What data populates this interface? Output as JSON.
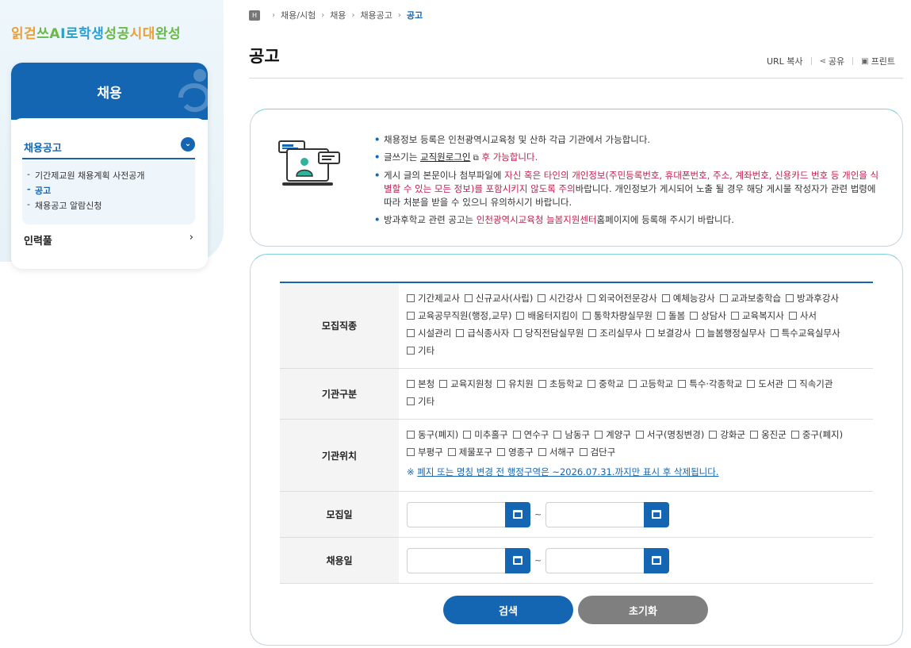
{
  "slogan": "읽걷쓰AI로 학생성공시대 완성",
  "sidebar": {
    "title": "채용",
    "menu": [
      {
        "label": "채용공고",
        "expanded": true,
        "children": [
          "기간제교원 채용계획 사전공개",
          "공고",
          "채용공고 알람신청"
        ]
      },
      {
        "label": "인력풀"
      }
    ]
  },
  "breadcrumb": [
    "채용/시험",
    "채용",
    "채용공고",
    "공고"
  ],
  "page_title": "공고",
  "utils": {
    "url_copy": "URL 복사",
    "share": "공유",
    "print": "프린트"
  },
  "notice": {
    "items": [
      "채용정보 등록은 인천광역시교육청 및 산하 각급 기관에서 가능합니다.",
      {
        "pre": "글쓰기는 ",
        "link": "교직원로그인",
        "post": " 후 가능합니다."
      },
      {
        "pre": "게시 글의 본문이나 첨부파일에 ",
        "red": "자신 혹은 타인의 개인정보(주민등록번호, 휴대폰번호, 주소, 계좌번호, 신용카드 번호 등 개인을 식별할 수 있는 모든 정보)를 포함시키지 않도록 주의",
        "post": "바랍니다. 개인정보가 게시되어 노출 될 경우 해당 게시물 작성자가 관련 법령에 따라 처분을 받을 수 있으니 유의하시기 바랍니다."
      },
      {
        "pre": "방과후학교 관련 공고는 ",
        "red": "인천광역시교육청 늘봄지원센터",
        "post": "홈페이지에 등록해 주시기 바랍니다."
      }
    ]
  },
  "search": {
    "recruit_type": {
      "label": "모집직종",
      "options": [
        "기간제교사",
        "신규교사(사립)",
        "시간강사",
        "외국어전문강사",
        "예체능강사",
        "교과보충학습",
        "방과후강사",
        "교육공무직원(행정,교무)",
        "배움터지킴이",
        "통학차량실무원",
        "돌봄",
        "상담사",
        "교육복지사",
        "사서",
        "시설관리",
        "급식종사자",
        "당직전담실무원",
        "조리실무사",
        "보결강사",
        "늘봄행정실무사",
        "특수교육실무사",
        "기타"
      ]
    },
    "org_type": {
      "label": "기관구분",
      "options": [
        "본청",
        "교육지원청",
        "유치원",
        "초등학교",
        "중학교",
        "고등학교",
        "특수·각종학교",
        "도서관",
        "직속기관",
        "기타"
      ]
    },
    "org_location": {
      "label": "기관위치",
      "options": [
        "동구(폐지)",
        "미추홀구",
        "연수구",
        "남동구",
        "계양구",
        "서구(명칭변경)",
        "강화군",
        "옹진군",
        "중구(폐지)",
        "부평구",
        "제물포구",
        "영종구",
        "서해구",
        "검단구"
      ],
      "note_mark": "※",
      "note": "폐지 또는 명칭 변경 전 행정구역은 ~2026.07.31.까지만 표시 후 삭제됩니다."
    },
    "recruit_date": {
      "label": "모집일",
      "from": "",
      "to": "",
      "sep": "~"
    },
    "hire_date": {
      "label": "채용일",
      "from": "",
      "to": "",
      "sep": "~"
    },
    "search_label": "검색",
    "reset_label": "초기화"
  },
  "colors": {
    "primary": "#1466b3",
    "accent_red": "#c21d4e",
    "reset_gray": "#7f7f7f"
  }
}
